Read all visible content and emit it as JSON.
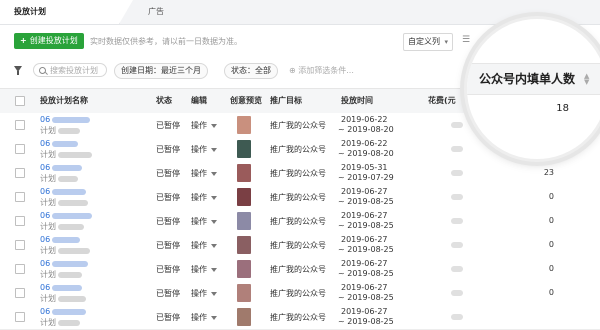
{
  "tabs": [
    {
      "label": "投放计划",
      "active": true
    },
    {
      "label": "广告",
      "active": false
    }
  ],
  "toolbar": {
    "create_label": "创建投放计划",
    "create_icon": "plus-icon",
    "hint": "实时数据仅供参考，请以前一日数据为准。",
    "custom_columns_label": "自定义列",
    "custom_columns_icon": "chevron-down-icon"
  },
  "filters": {
    "search_placeholder": "搜索投放计划",
    "date_chip": "创建日期：最近三个月",
    "status_chip": "状态：全部",
    "add_filter": "添加筛选条件..."
  },
  "table": {
    "headers": {
      "name": "投放计划名称",
      "status": "状态",
      "edit": "编辑",
      "preview": "创意预览",
      "target": "推广目标",
      "time": "投放时间",
      "spend": "花费(元",
      "followers": "公众号内填单人数"
    },
    "rows": [
      {
        "name_prefix": "06",
        "name_sub": "计划",
        "status": "已暂停",
        "op": "操作",
        "target": "推广我的公众号",
        "time_start": "2019-06-22",
        "time_end": "~ 2019-08-20",
        "followers": "18",
        "thumb": "#c9907e"
      },
      {
        "name_prefix": "06",
        "name_sub": "计划",
        "status": "已暂停",
        "op": "操作",
        "target": "推广我的公众号",
        "time_start": "2019-06-22",
        "time_end": "~ 2019-08-20",
        "followers": "",
        "thumb": "#3e5a52"
      },
      {
        "name_prefix": "06",
        "name_sub": "计划",
        "status": "已暂停",
        "op": "操作",
        "target": "推广我的公众号",
        "time_start": "2019-05-31",
        "time_end": "~ 2019-07-29",
        "followers": "23",
        "thumb": "#9a5b5b"
      },
      {
        "name_prefix": "06",
        "name_sub": "计划",
        "status": "已暂停",
        "op": "操作",
        "target": "推广我的公众号",
        "time_start": "2019-06-27",
        "time_end": "~ 2019-08-25",
        "followers": "0",
        "thumb": "#7a3f44"
      },
      {
        "name_prefix": "06",
        "name_sub": "计划",
        "status": "已暂停",
        "op": "操作",
        "target": "推广我的公众号",
        "time_start": "2019-06-27",
        "time_end": "~ 2019-08-25",
        "followers": "0",
        "thumb": "#8c8aa6"
      },
      {
        "name_prefix": "06",
        "name_sub": "计划",
        "status": "已暂停",
        "op": "操作",
        "target": "推广我的公众号",
        "time_start": "2019-06-27",
        "time_end": "~ 2019-08-25",
        "followers": "0",
        "thumb": "#8a5f62"
      },
      {
        "name_prefix": "06",
        "name_sub": "计划",
        "status": "已暂停",
        "op": "操作",
        "target": "推广我的公众号",
        "time_start": "2019-06-27",
        "time_end": "~ 2019-08-25",
        "followers": "0",
        "thumb": "#9b6f7c"
      },
      {
        "name_prefix": "06",
        "name_sub": "计划",
        "status": "已暂停",
        "op": "操作",
        "target": "推广我的公众号",
        "time_start": "2019-06-27",
        "time_end": "~ 2019-08-25",
        "followers": "0",
        "thumb": "#b0807a"
      },
      {
        "name_prefix": "06",
        "name_sub": "计划",
        "status": "已暂停",
        "op": "操作",
        "target": "推广我的公众号",
        "time_start": "2019-06-27",
        "time_end": "~ 2019-08-25",
        "followers": "",
        "thumb": "#a07a6c"
      }
    ]
  },
  "magnifier": {
    "header": "公众号内填单人数",
    "value": "18"
  },
  "colors": {
    "accent_green": "#2aa33a",
    "link_blue": "#2b6fd6"
  }
}
